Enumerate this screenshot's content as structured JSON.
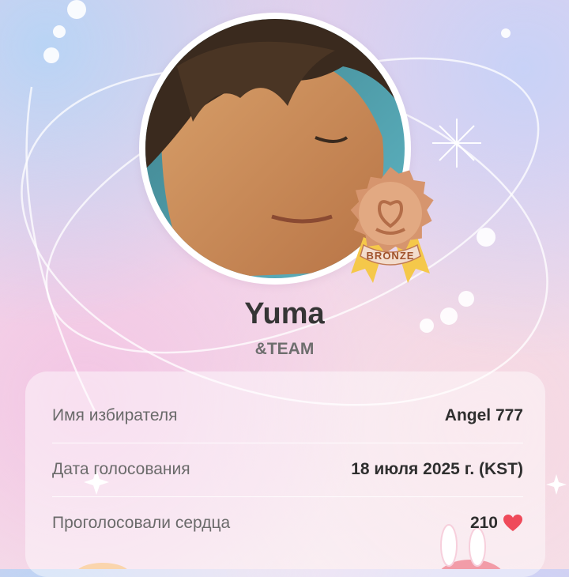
{
  "profile": {
    "name": "Yuma",
    "group": "&TEAM",
    "badge_label": "BRONZE"
  },
  "details": [
    {
      "label": "Имя избирателя",
      "value": "Angel 777"
    },
    {
      "label": "Дата голосования",
      "value": "18 июля 2025 г. (KST)"
    },
    {
      "label": "Проголосовали сердца",
      "value": "210"
    }
  ],
  "icons": {
    "badge": "bronze-medal-icon",
    "heart": "heart-icon",
    "moon": "crescent-moon-icon",
    "sparkle": "sparkle-icon"
  },
  "colors": {
    "heart": "#ef4a5a",
    "badge_bronze": "#d6956e",
    "ribbon": "#f5c84a"
  }
}
